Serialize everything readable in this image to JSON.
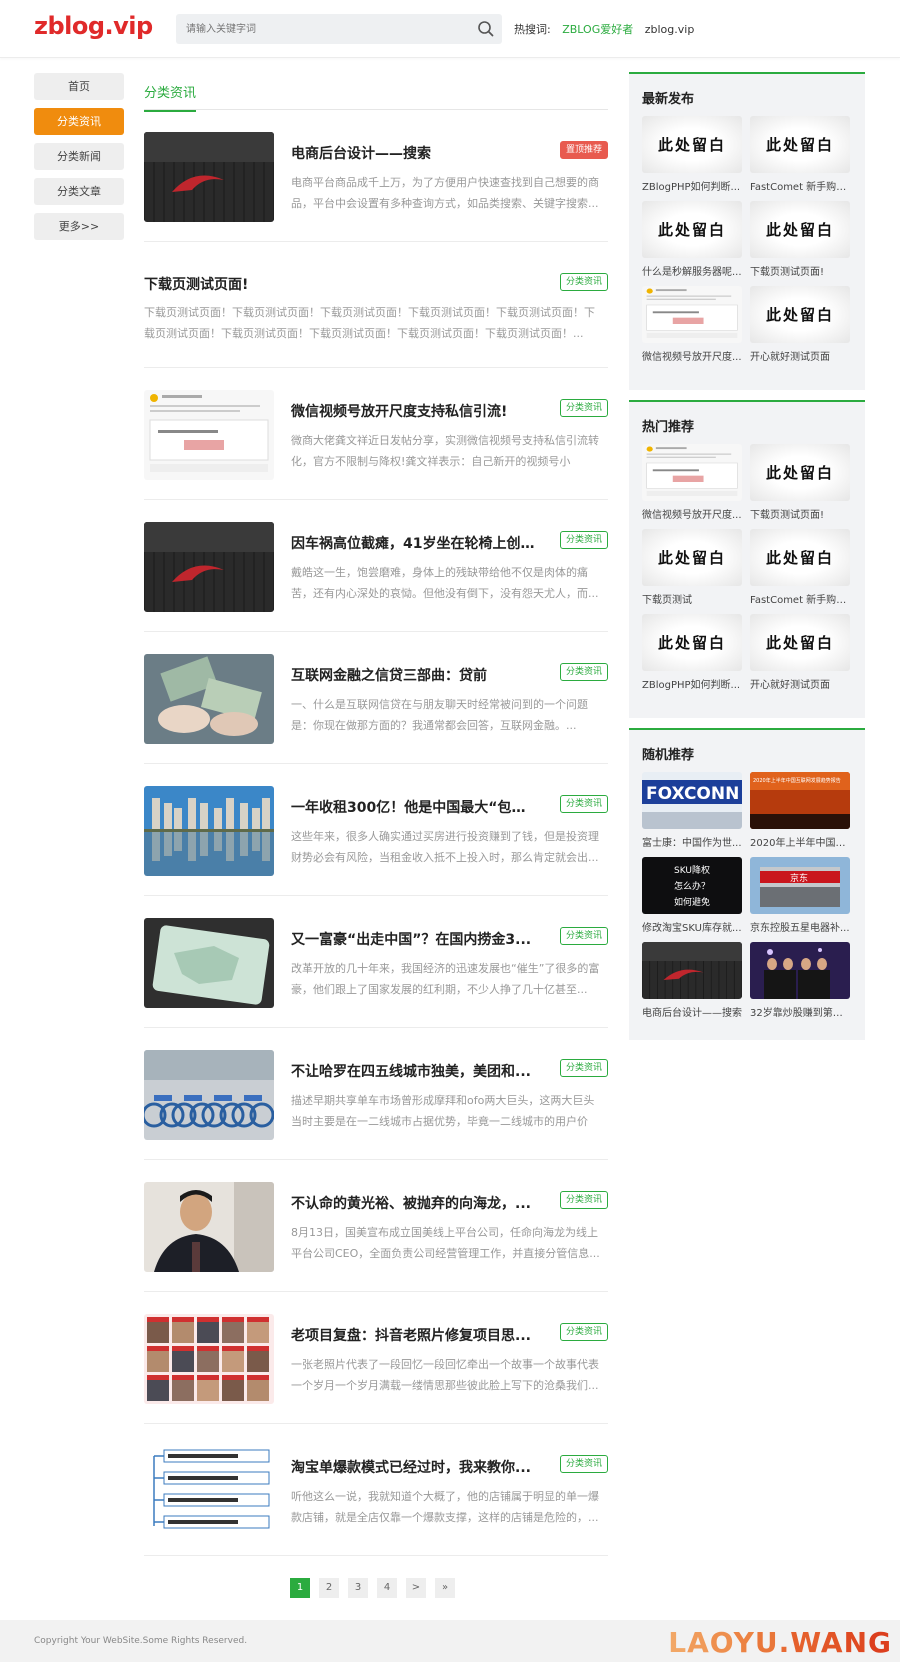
{
  "header": {
    "logo": "zblog.vip",
    "search_placeholder": "请输入关键字词",
    "hot_label": "热搜词:",
    "hot_words": [
      "ZBLOG爱好者",
      "zblog.vip"
    ]
  },
  "leftnav": [
    "首页",
    "分类资讯",
    "分类新闻",
    "分类文章",
    "更多>>"
  ],
  "main": {
    "tab": "分类资讯",
    "items": [
      {
        "title": "电商后台设计——搜索",
        "desc": "电商平台商品成千上万，为了方便用户快速查找到自己想要的商品，平台中会设置有多种查询方式，如品类搜索、关键字搜索...",
        "badge": "置顶推荐",
        "badge_style": "red",
        "thumb": "dark-logo"
      },
      {
        "title": "下载页测试页面!",
        "desc": "下载页测试页面！下载页测试页面！下载页测试页面！下载页测试页面！下载页测试页面！下载页测试页面！下载页测试页面！下载页测试页面！下载页测试页面！下载页测试页面！...",
        "badge": "分类资讯",
        "badge_style": "green",
        "thumb": "none"
      },
      {
        "title": "微信视频号放开尺度支持私信引流!",
        "desc": "微商大佬龚文祥近日发帖分享，实测微信视频号支持私信引流转化，官方不限制与降权!龚文祥表示：自己新开的视频号小号，...",
        "badge": "分类资讯",
        "badge_style": "green",
        "thumb": "screenshot"
      },
      {
        "title": "因车祸高位截瘫，41岁坐在轮椅上创...",
        "desc": "戴皓这一生，饱尝磨难，身体上的残缺带给他不仅是肉体的痛苦，还有内心深处的哀恸。但他没有倒下，没有怨天尤人，而...",
        "badge": "分类资讯",
        "badge_style": "green",
        "thumb": "dark-logo"
      },
      {
        "title": "互联网金融之信贷三部曲：贷前",
        "desc": "一、什么是互联网信贷在与朋友聊天时经常被问到的一个问题是：你现在做那方面的？我通常都会回答，互联网金融。...",
        "badge": "分类资讯",
        "badge_style": "green",
        "thumb": "money"
      },
      {
        "title": "一年收租300亿！他是中国最大“包租...",
        "desc": "这些年来，很多人确实通过买房进行投资赚到了钱，但是投资理财势必会有风险，当租金收入抵不上投入时，那么肯定就会出...",
        "badge": "分类资讯",
        "badge_style": "green",
        "thumb": "city"
      },
      {
        "title": "又一富豪“出走中国”？在国内捞金3...",
        "desc": "改革开放的几十年来，我国经济的迅速发展也“催生”了很多的富豪，他们跟上了国家发展的红利期，不少人挣了几十亿甚至...",
        "badge": "分类资讯",
        "badge_style": "green",
        "thumb": "card"
      },
      {
        "title": "不让哈罗在四五线城市独美，美团和...",
        "desc": "描述早期共享单车市场曾形成摩拜和ofo两大巨头，这两大巨头当时主要是在一二线城市占据优势，毕竟一二线城市的用户价值...",
        "badge": "分类资讯",
        "badge_style": "green",
        "thumb": "bikes"
      },
      {
        "title": "不认命的黄光裕、被抛弃的向海龙，...",
        "desc": "8月13日，国美宣布成立国美线上平台公司，任命向海龙为线上平台公司CEO，全面负责公司经营管理工作，并直接分管信息...",
        "badge": "分类资讯",
        "badge_style": "green",
        "thumb": "man"
      },
      {
        "title": "老项目复盘：抖音老照片修复项目思...",
        "desc": "一张老照片代表了一段回忆一段回忆牵出一个故事一个故事代表一个岁月一个岁月满载一缕情思那些彼此脸上写下的沧桑我们...",
        "badge": "分类资讯",
        "badge_style": "green",
        "thumb": "photos"
      },
      {
        "title": "淘宝单爆款模式已经过时，我来教你...",
        "desc": "听他这么一说，我就知道个大概了，他的店铺属于明显的单一爆款店铺，就是全店仅靠一个爆款支撑，这样的店铺是危险的，...",
        "badge": "分类资讯",
        "badge_style": "green",
        "thumb": "diagram"
      }
    ]
  },
  "pager": [
    "1",
    "2",
    "3",
    "4",
    ">",
    "»"
  ],
  "sidebar": {
    "latest": {
      "title": "最新发布",
      "placeholder_text": "此处留白",
      "items": [
        {
          "cap": "ZBlogPHP如何判断...",
          "pic": "placeholder"
        },
        {
          "cap": "FastComet 新手购买...",
          "pic": "placeholder"
        },
        {
          "cap": "什么是秒解服务器呢...",
          "pic": "placeholder"
        },
        {
          "cap": "下载页测试页面!",
          "pic": "placeholder"
        },
        {
          "cap": "微信视频号放开尺度...",
          "pic": "screenshot"
        },
        {
          "cap": "开心就好测试页面",
          "pic": "placeholder"
        }
      ]
    },
    "hot": {
      "title": "热门推荐",
      "items": [
        {
          "cap": "微信视频号放开尺度...",
          "pic": "screenshot"
        },
        {
          "cap": "下载页测试页面!",
          "pic": "placeholder"
        },
        {
          "cap": "下载页测试",
          "pic": "placeholder"
        },
        {
          "cap": "FastComet 新手购买...",
          "pic": "placeholder"
        },
        {
          "cap": "ZBlogPHP如何判断...",
          "pic": "placeholder"
        },
        {
          "cap": "开心就好测试页面",
          "pic": "placeholder"
        }
      ]
    },
    "random": {
      "title": "随机推荐",
      "items": [
        {
          "cap": "富士康：中国作为世...",
          "pic": "foxconn"
        },
        {
          "cap": "2020年上半年中国互...",
          "pic": "stage"
        },
        {
          "cap": "修改淘宝SKU库存就...",
          "pic": "sku"
        },
        {
          "cap": "京东控股五星电器补...",
          "pic": "jd"
        },
        {
          "cap": "电商后台设计——搜索",
          "pic": "dark-logo"
        },
        {
          "cap": "32岁靠炒股赚到第一...",
          "pic": "ceremony"
        }
      ]
    },
    "pic_texts": {
      "foxconn": "FOXCONN",
      "stage": "2020年上半年中国互联网发展趋势报告",
      "sku": [
        "SKU降权",
        "怎么办？",
        "如何避免"
      ],
      "jd": "京东"
    }
  },
  "footer": {
    "copyright": "Copyright Your WebSite.Some Rights Reserved.",
    "watermark": "LAOYU.WANG"
  }
}
